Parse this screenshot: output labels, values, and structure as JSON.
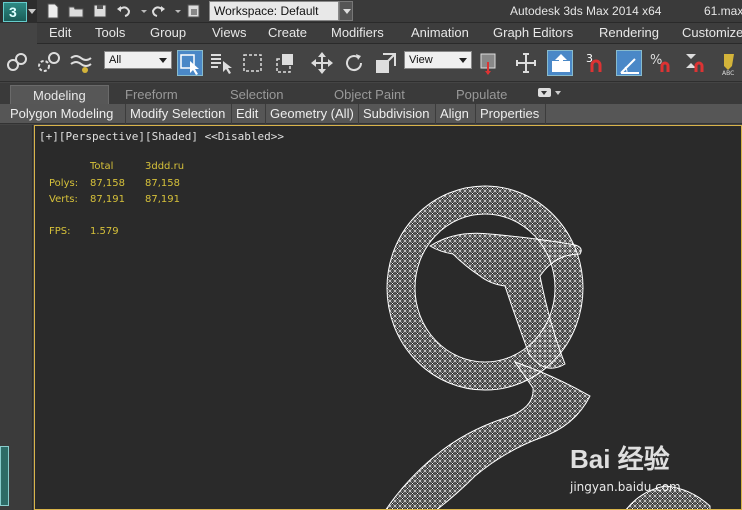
{
  "titlebar": {
    "workspace_label": "Workspace: Default",
    "app_title": "Autodesk 3ds Max  2014 x64",
    "file_title": "61.max"
  },
  "menu": {
    "items": [
      "Edit",
      "Tools",
      "Group",
      "Views",
      "Create",
      "Modifiers",
      "Animation",
      "Graph Editors",
      "Rendering",
      "Customize"
    ]
  },
  "toolbar": {
    "selection_filter": "All",
    "ref_coord": "View"
  },
  "ribbon": {
    "tabs": [
      "Modeling",
      "Freeform",
      "Selection",
      "Object Paint",
      "Populate"
    ],
    "active_tab": "Modeling",
    "panels": [
      "Polygon Modeling",
      "Modify Selection",
      "Edit",
      "Geometry (All)",
      "Subdivision",
      "Align",
      "Properties"
    ]
  },
  "viewport": {
    "label": "[+][Perspective][Shaded] <<Disabled>>",
    "stats": {
      "col_total": "Total",
      "col_object": "3ddd.ru",
      "polys_label": "Polys:",
      "polys_total": "87,158",
      "polys_object": "87,158",
      "verts_label": "Verts:",
      "verts_total": "87,191",
      "verts_object": "87,191",
      "fps_label": "FPS:",
      "fps_value": "1.579"
    }
  },
  "watermark": {
    "brand": "Bai 经验",
    "url": "jingyan.baidu.com"
  },
  "colors": {
    "viewport_border": "#d9b44a",
    "stats_text": "#d6c13a",
    "active_tool": "#4a88c7"
  }
}
